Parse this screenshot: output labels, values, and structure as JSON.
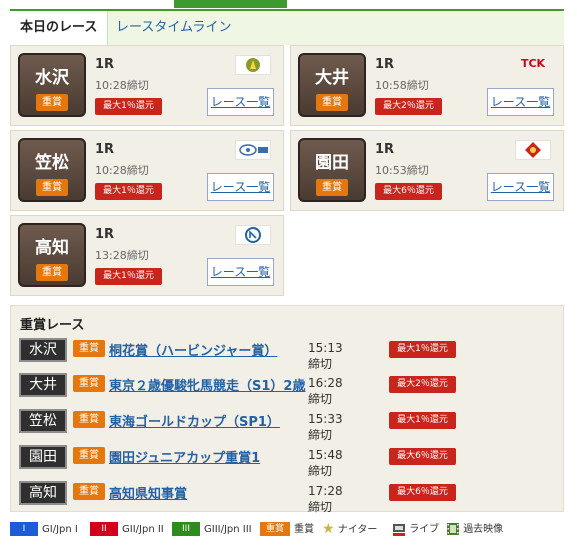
{
  "tabs": {
    "active": "本日のレース",
    "timeline": "レースタイムライン"
  },
  "cards": [
    {
      "course": "水沢",
      "badge": "重賞",
      "race": "1R",
      "close": "10:28締切",
      "return": "最大1％還元",
      "button": "レース一覧",
      "logo_text": "",
      "logo_color": "#8a9a2a"
    },
    {
      "course": "大井",
      "badge": "重賞",
      "race": "1R",
      "close": "10:58締切",
      "return": "最大2％還元",
      "button": "レース一覧",
      "logo_text": "TCK",
      "logo_color": "#d0021b"
    },
    {
      "course": "笠松",
      "badge": "重賞",
      "race": "1R",
      "close": "10:28締切",
      "return": "最大1％還元",
      "button": "レース一覧",
      "logo_text": "",
      "logo_color": "#3a6ea8"
    },
    {
      "course": "園田",
      "badge": "重賞",
      "race": "1R",
      "close": "10:53締切",
      "return": "最大6％還元",
      "button": "レース一覧",
      "logo_text": "",
      "logo_color": "#c8261d"
    },
    {
      "course": "高知",
      "badge": "重賞",
      "race": "1R",
      "close": "13:28締切",
      "return": "最大1％還元",
      "button": "レース一覧",
      "logo_text": "",
      "logo_color": "#2462a6"
    }
  ],
  "grade_section": {
    "title": "重賞レース",
    "rows": [
      {
        "course": "水沢",
        "badge": "重賞",
        "name": "桐花賞（ハービンジャー賞）",
        "close": "15:13締切",
        "return": "最大1％還元"
      },
      {
        "course": "大井",
        "badge": "重賞",
        "name": "東京２歳優駿牝馬競走（S1）2歳",
        "close": "16:28締切",
        "return": "最大2％還元"
      },
      {
        "course": "笠松",
        "badge": "重賞",
        "name": "東海ゴールドカップ（SP1）",
        "close": "15:33締切",
        "return": "最大1％還元"
      },
      {
        "course": "園田",
        "badge": "重賞",
        "name": "園田ジュニアカップ重賞1",
        "close": "15:48締切",
        "return": "最大6％還元"
      },
      {
        "course": "高知",
        "badge": "重賞",
        "name": "高知県知事賞",
        "close": "17:28締切",
        "return": "最大6％還元"
      }
    ]
  },
  "legend": {
    "g1_symbol": "I",
    "g1_label": "GI/Jpn I",
    "g2_symbol": "II",
    "g2_label": "GII/Jpn II",
    "g3_symbol": "III",
    "g3_label": "GIII/Jpn III",
    "grade_symbol": "重賞",
    "grade_label": "重賞",
    "nighter_label": "ナイター",
    "live_label": "ライブ",
    "replay_label": "過去映像",
    "colors": {
      "g1": "#1e5bd6",
      "g2": "#d0021b",
      "g3": "#2e8b1e",
      "grade": "#e4780f"
    }
  }
}
